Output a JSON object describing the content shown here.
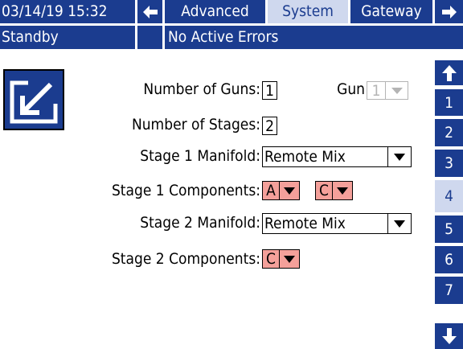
{
  "header": {
    "datetime": "03/14/19 15:32",
    "tabs": [
      "Advanced",
      "System",
      "Gateway"
    ],
    "active_tab": "System"
  },
  "status": {
    "mode": "Standby",
    "errors": "No Active Errors"
  },
  "form": {
    "num_guns_label": "Number of Guns:",
    "num_guns_value": "1",
    "gun_label": "Gun",
    "gun_value": "1",
    "num_stages_label": "Number of Stages:",
    "num_stages_value": "2",
    "stage1_manifold_label": "Stage 1 Manifold:",
    "stage1_manifold_value": "Remote Mix",
    "stage1_components_label": "Stage 1 Components:",
    "stage1_components": [
      "A",
      "C"
    ],
    "stage2_manifold_label": "Stage 2 Manifold:",
    "stage2_manifold_value": "Remote Mix",
    "stage2_components_label": "Stage 2 Components:",
    "stage2_components": [
      "C"
    ]
  },
  "side_pages": [
    "1",
    "2",
    "3",
    "4",
    "5",
    "6",
    "7"
  ],
  "active_page": "4",
  "icons": [
    "arrow-left-icon",
    "arrow-right-icon",
    "arrow-up-icon",
    "arrow-down-icon",
    "edit-icon",
    "dropdown-arrow-icon"
  ],
  "colors": {
    "header_bg": "#1b3c8f",
    "active_tab_bg": "#cfd8ee",
    "component_bg": "#f4a09a",
    "disabled": "#b4b4b4"
  }
}
